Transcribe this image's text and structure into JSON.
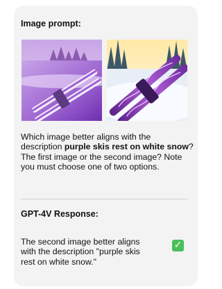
{
  "prompt_heading": "Image prompt:",
  "question": {
    "before": "Which image better aligns with the description ",
    "highlight": "purple skis rest on white snow",
    "after": "? The first image or the second image? Note you must choose one of two options."
  },
  "response_heading": "GPT-4V Response:",
  "response_text": "The second image better aligns with the description \"purple skis rest on white snow.\"",
  "check_symbol": "✓",
  "colors": {
    "card": "#f3f3f3",
    "check": "#4bbf5a"
  }
}
